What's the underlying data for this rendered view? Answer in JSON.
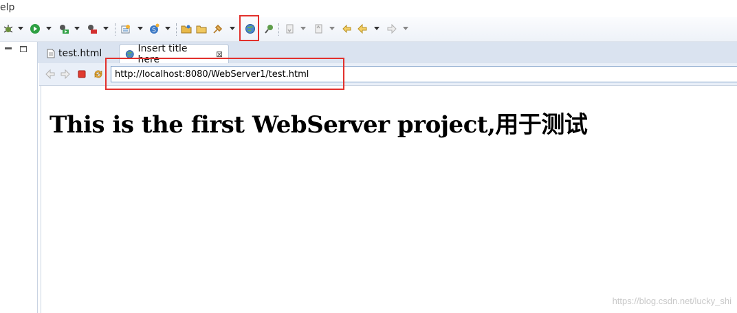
{
  "menubar": {
    "visible_item": "elp"
  },
  "toolbar": {
    "icons": [
      "debug-icon",
      "run-icon",
      "run-external-tool-icon",
      "coverage-icon",
      "new-server-icon",
      "new-java-class-icon",
      "open-folder-icon",
      "open-project-icon",
      "deploy-icon",
      "open-web-browser-icon",
      "search-icon",
      "next-annotation-icon",
      "previous-annotation-icon",
      "last-edit-icon",
      "back-icon",
      "forward-icon"
    ],
    "highlighted_button": "open-web-browser-icon"
  },
  "tabs": [
    {
      "label": "test.html",
      "active": false,
      "icon": "html-file-icon"
    },
    {
      "label": "Insert title here",
      "active": true,
      "icon": "globe-icon",
      "close_glyph": "⊠"
    }
  ],
  "browser": {
    "url": "http://localhost:8080/WebServer1/test.html",
    "page_heading": "This is the first WebServer project,用于测试"
  },
  "watermark": "https://blog.csdn.net/lucky_shi",
  "colors": {
    "highlight": "#e2302c",
    "tabbar": "#dae3f0",
    "navbar": "#e9eff8"
  }
}
